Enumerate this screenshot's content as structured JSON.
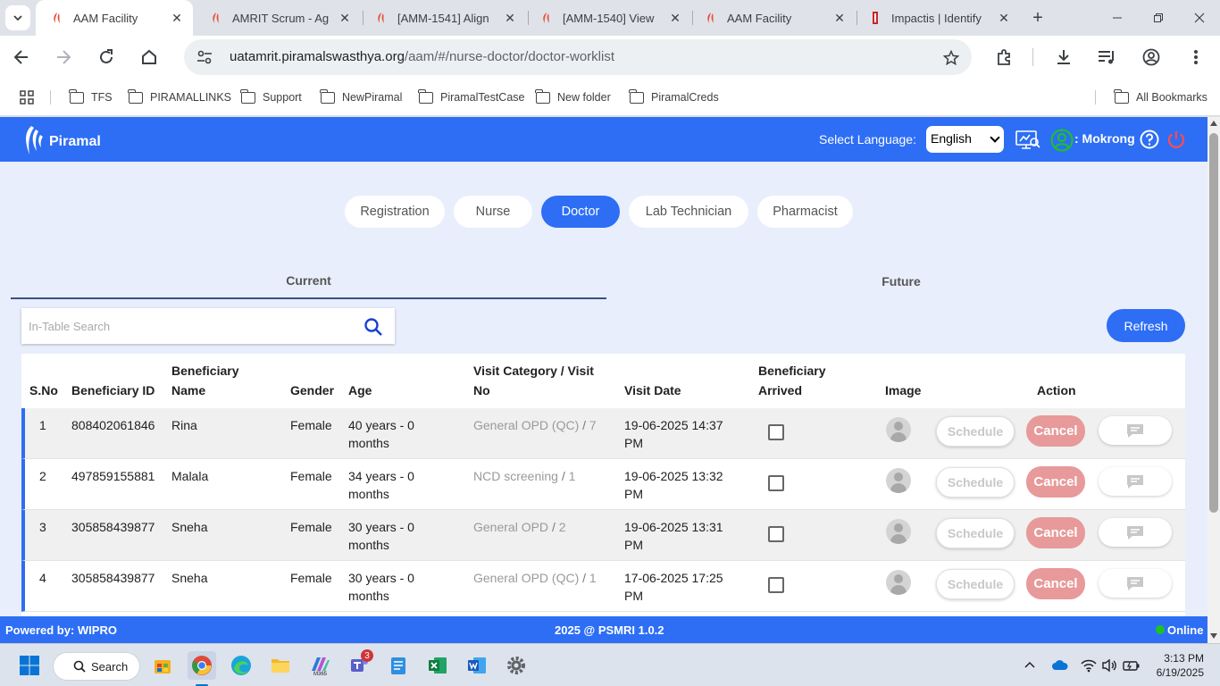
{
  "browser": {
    "tabs": [
      {
        "title": "AAM Facility",
        "active": true
      },
      {
        "title": "AMRIT Scrum - Ag"
      },
      {
        "title": "[AMM-1541] Align"
      },
      {
        "title": "[AMM-1540] View"
      },
      {
        "title": "AAM Facility"
      },
      {
        "title": "Impactis | Identify"
      }
    ],
    "url_host": "uatamrit.piramalswasthya.org",
    "url_path": "/aam/#/nurse-doctor/doctor-worklist",
    "bookmarks": [
      "TFS",
      "PIRAMALLINKS",
      "Support",
      "NewPiramal",
      "PiramalTestCase",
      "New folder",
      "PiramalCreds"
    ],
    "all_bookmarks": "All Bookmarks"
  },
  "app": {
    "brand": "Piramal",
    "select_language_label": "Select Language:",
    "language": "English",
    "user_label": ": Mokrong",
    "roles": [
      "Registration",
      "Nurse",
      "Doctor",
      "Lab Technician",
      "Pharmacist"
    ],
    "active_role": "Doctor",
    "worklist_tabs": [
      "Current",
      "Future"
    ],
    "search_placeholder": "In-Table Search",
    "refresh_label": "Refresh",
    "columns": {
      "sno": "S.No",
      "beneficiary_id": "Beneficiary ID",
      "beneficiary_name_1": "Beneficiary",
      "beneficiary_name_2": "Name",
      "gender": "Gender",
      "age": "Age",
      "visit_1": "Visit Category / Visit",
      "visit_2": "No",
      "visit_date": "Visit Date",
      "arrived_1": "Beneficiary",
      "arrived_2": "Arrived",
      "image": "Image",
      "action": "Action"
    },
    "rows": [
      {
        "sno": "1",
        "id": "808402061846",
        "name": "Rina",
        "gender": "Female",
        "age_1": "40 years - 0",
        "age_2": "months",
        "category": "General OPD (QC)",
        "visit_no": "7",
        "date_1": "19-06-2025 14:37",
        "date_2": "PM"
      },
      {
        "sno": "2",
        "id": "497859155881",
        "name": "Malala",
        "gender": "Female",
        "age_1": "34 years - 0",
        "age_2": "months",
        "category": "NCD screening",
        "visit_no": "1",
        "date_1": "19-06-2025 13:32",
        "date_2": "PM"
      },
      {
        "sno": "3",
        "id": "305858439877",
        "name": "Sneha",
        "gender": "Female",
        "age_1": "30 years - 0",
        "age_2": "months",
        "category": "General OPD",
        "visit_no": "2",
        "date_1": "19-06-2025 13:31",
        "date_2": "PM"
      },
      {
        "sno": "4",
        "id": "305858439877",
        "name": "Sneha",
        "gender": "Female",
        "age_1": "30 years - 0",
        "age_2": "months",
        "category": "General OPD (QC)",
        "visit_no": "1",
        "date_1": "17-06-2025 17:25",
        "date_2": "PM"
      }
    ],
    "schedule_label": "Schedule",
    "cancel_label": "Cancel",
    "slash": "/",
    "footer": {
      "powered_by": "Powered by: WIPRO",
      "copyright": "2025 @ PSMRI 1.0.2",
      "status": "Online"
    }
  },
  "taskbar": {
    "search_label": "Search",
    "teams_badge": "3",
    "time": "3:13 PM",
    "date": "6/19/2025"
  },
  "colors": {
    "primary": "#2d6ef5",
    "cancel": "#e79a99",
    "online": "#1ec41e"
  }
}
